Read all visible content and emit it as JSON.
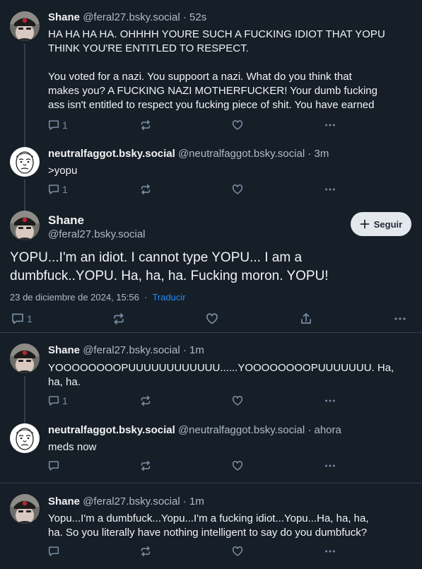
{
  "posts": [
    {
      "name": "Shane",
      "handle": "@feral27.bsky.social",
      "separator": "·",
      "time": "52s",
      "text_lines": [
        "HA HA HA HA. OHHHH YOURE SUCH A FUCKING IDIOT THAT YOPU",
        "THINK YOU'RE ENTITLED TO RESPECT.",
        "",
        "You voted for a nazi. You suppoort a nazi. What do you think that",
        "makes you?  A FUCKING NAZI MOTHERFUCKER!   Your dumb fucking",
        "ass isn't entitled to respect you fucking piece of shit. You have earned"
      ],
      "reply_count": "1",
      "avatar": "shane-avatar"
    },
    {
      "name": "neutralfaggot.bsky.social",
      "handle": "@neutralfaggot.bsky.social",
      "separator": "·",
      "time": "3m",
      "text_lines": [
        ">yopu"
      ],
      "reply_count": "1",
      "avatar": "wojak-avatar"
    },
    {
      "name": "Shane",
      "handle": "@feral27.bsky.social",
      "separator": "·",
      "time": "1m",
      "text_lines": [
        "YOOOOOOOOPUUUUUUUUUUUU......YOOOOOOOOPUUUUUUU.  Ha,",
        "ha, ha."
      ],
      "reply_count": "1",
      "avatar": "shane-avatar"
    },
    {
      "name": "neutralfaggot.bsky.social",
      "handle": "@neutralfaggot.bsky.social",
      "separator": "·",
      "time": "ahora",
      "text_lines": [
        "meds now"
      ],
      "reply_count": "",
      "avatar": "wojak-avatar"
    },
    {
      "name": "Shane",
      "handle": "@feral27.bsky.social",
      "separator": "·",
      "time": "1m",
      "text_lines": [
        "Yopu...I'm a dumbfuck...Yopu...I'm a fucking idiot...Yopu...Ha, ha, ha,",
        "ha. So you literally have nothing intelligent to say do you dumbfuck?"
      ],
      "reply_count": "",
      "avatar": "shane-avatar"
    }
  ],
  "focused": {
    "name": "Shane",
    "handle": "@feral27.bsky.social",
    "follow_label": "Seguir",
    "follow_icon": "plus-icon",
    "text_lines": [
      "YOPU...I'm an idiot. I cannot type YOPU... I am a",
      "dumbfuck..YOPU.  Ha, ha, ha. Fucking moron. YOPU!"
    ],
    "date": "23 de diciembre de 2024, 15:56",
    "separator": "·",
    "translate": "Traducir",
    "reply_count": "1"
  },
  "icons": {
    "reply": "reply-icon",
    "repost": "repost-icon",
    "like": "heart-icon",
    "share": "share-icon",
    "more": "more-icon"
  },
  "colors": {
    "background": "#161e27",
    "text": "#f1f3f5",
    "muted": "#aebbc9",
    "icon": "#788ea5",
    "link": "#208bfe",
    "divider": "#2e4052"
  }
}
